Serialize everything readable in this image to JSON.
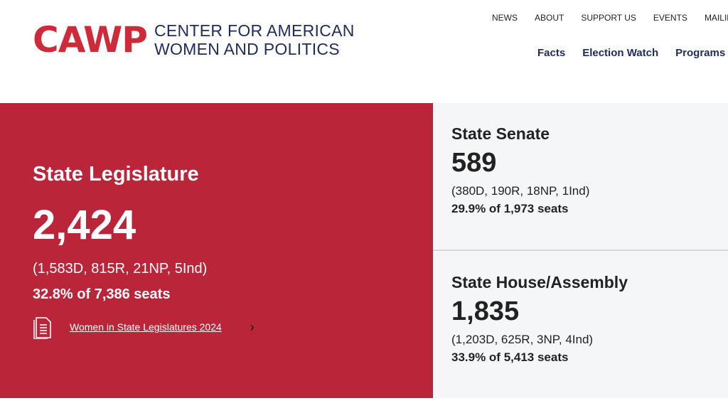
{
  "logo": {
    "mark": "CAWP",
    "line1": "CENTER FOR AMERICAN",
    "line2": "WOMEN AND POLITICS"
  },
  "top_nav": [
    "NEWS",
    "ABOUT",
    "SUPPORT US",
    "EVENTS",
    "MAILING LI"
  ],
  "main_nav": [
    "Facts",
    "Election Watch",
    "Programs"
  ],
  "colors": {
    "accent_red": "#bb2539",
    "navy": "#1f2b5c"
  },
  "legislature": {
    "title": "State Legislature",
    "count": "2,424",
    "breakdown": "(1,583D, 815R, 21NP, 5Ind)",
    "share": "32.8% of 7,386 seats",
    "link": "Women in State Legislatures 2024",
    "link_icon": "document-icon"
  },
  "senate": {
    "title": "State Senate",
    "count": "589",
    "breakdown": "(380D, 190R, 18NP, 1Ind)",
    "share": "29.9% of 1,973 seats"
  },
  "house": {
    "title": "State House/Assembly",
    "count": "1,835",
    "breakdown": "(1,203D, 625R, 3NP, 4Ind)",
    "share": "33.9% of 5,413 seats"
  }
}
